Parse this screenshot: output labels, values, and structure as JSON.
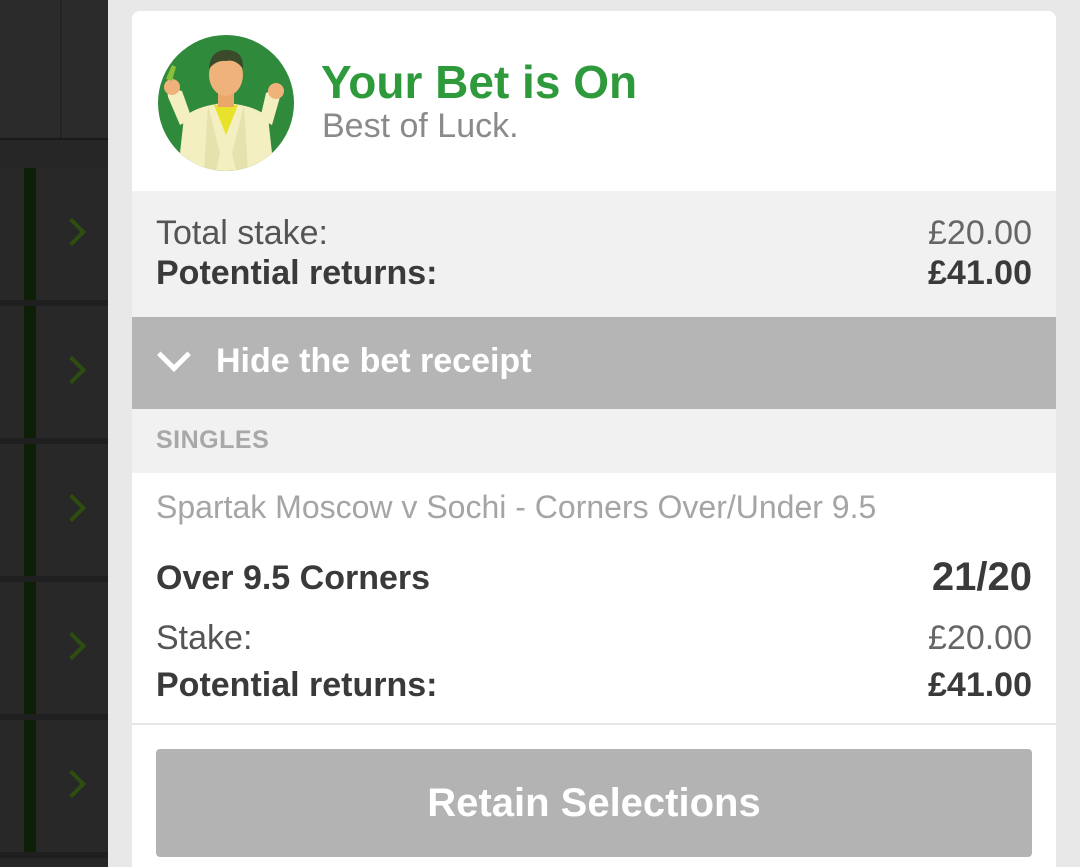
{
  "header": {
    "title": "Your Bet is On",
    "subtitle": "Best of Luck."
  },
  "totals": {
    "stake_label": "Total stake:",
    "stake_value": "£20.00",
    "returns_label": "Potential returns:",
    "returns_value": "£41.00"
  },
  "receipt_toggle": {
    "label": "Hide the bet receipt",
    "icon": "chevron-down-icon"
  },
  "section": {
    "label": "SINGLES"
  },
  "bet": {
    "event": "Spartak Moscow v Sochi - Corners Over/Under 9.5",
    "selection": "Over 9.5 Corners",
    "odds": "21/20",
    "stake_label": "Stake:",
    "stake_value": "£20.00",
    "returns_label": "Potential returns:",
    "returns_value": "£41.00"
  },
  "actions": {
    "retain_label": "Retain Selections"
  },
  "left_list": {
    "row_icon": "chevron-right-icon",
    "row_count": 5
  },
  "colors": {
    "accent_green": "#2e9a3c",
    "toggle_bg": "#b5b5b5",
    "button_bg": "#b3b3b3"
  }
}
